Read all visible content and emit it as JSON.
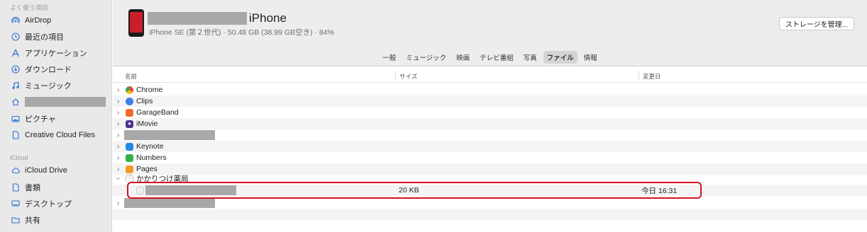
{
  "sidebar": {
    "favorites_heading": "よく使う項目",
    "favorites": [
      {
        "label": "AirDrop",
        "icon": "airdrop-icon"
      },
      {
        "label": "最近の項目",
        "icon": "clock-icon"
      },
      {
        "label": "アプリケーション",
        "icon": "applications-icon"
      },
      {
        "label": "ダウンロード",
        "icon": "download-icon"
      },
      {
        "label": "ミュージック",
        "icon": "music-icon"
      },
      {
        "label": "",
        "icon": "home-icon"
      },
      {
        "label": "ピクチャ",
        "icon": "pictures-icon"
      },
      {
        "label": "Creative Cloud Files",
        "icon": "document-icon"
      }
    ],
    "icloud_heading": "iCloud",
    "icloud": [
      {
        "label": "iCloud Drive",
        "icon": "cloud-icon"
      },
      {
        "label": "書類",
        "icon": "document-icon"
      },
      {
        "label": "デスクトップ",
        "icon": "desktop-icon"
      },
      {
        "label": "共有",
        "icon": "shared-folder-icon"
      }
    ]
  },
  "device": {
    "name": "iPhone",
    "info": "iPhone SE (第２世代) · 50.48 GB (38.99 GB空き) · 84%",
    "manage_button": "ストレージを管理..."
  },
  "tabs": [
    "一般",
    "ミュージック",
    "映画",
    "テレビ番組",
    "写真",
    "ファイル",
    "情報"
  ],
  "active_tab": "ファイル",
  "columns": {
    "name": "名前",
    "size": "サイズ",
    "modified": "変更日"
  },
  "rows": [
    {
      "name": "Chrome",
      "icon": "chrome-icon"
    },
    {
      "name": "Clips",
      "icon": "clips-icon"
    },
    {
      "name": "GarageBand",
      "icon": "garageband-icon"
    },
    {
      "name": "iMovie",
      "icon": "imovie-icon"
    },
    {
      "name": "",
      "icon": ""
    },
    {
      "name": "Keynote",
      "icon": "keynote-icon"
    },
    {
      "name": "Numbers",
      "icon": "numbers-icon"
    },
    {
      "name": "Pages",
      "icon": "pages-icon"
    },
    {
      "name": "かかりつけ薬局",
      "icon": "pharmacy-icon"
    }
  ],
  "file_row": {
    "size": "20 KB",
    "modified": "今日 16:31"
  },
  "colors": {
    "accent": "#2f6fd6",
    "highlight": "#d4121c",
    "sidebar_bg": "#e9e9e9"
  }
}
